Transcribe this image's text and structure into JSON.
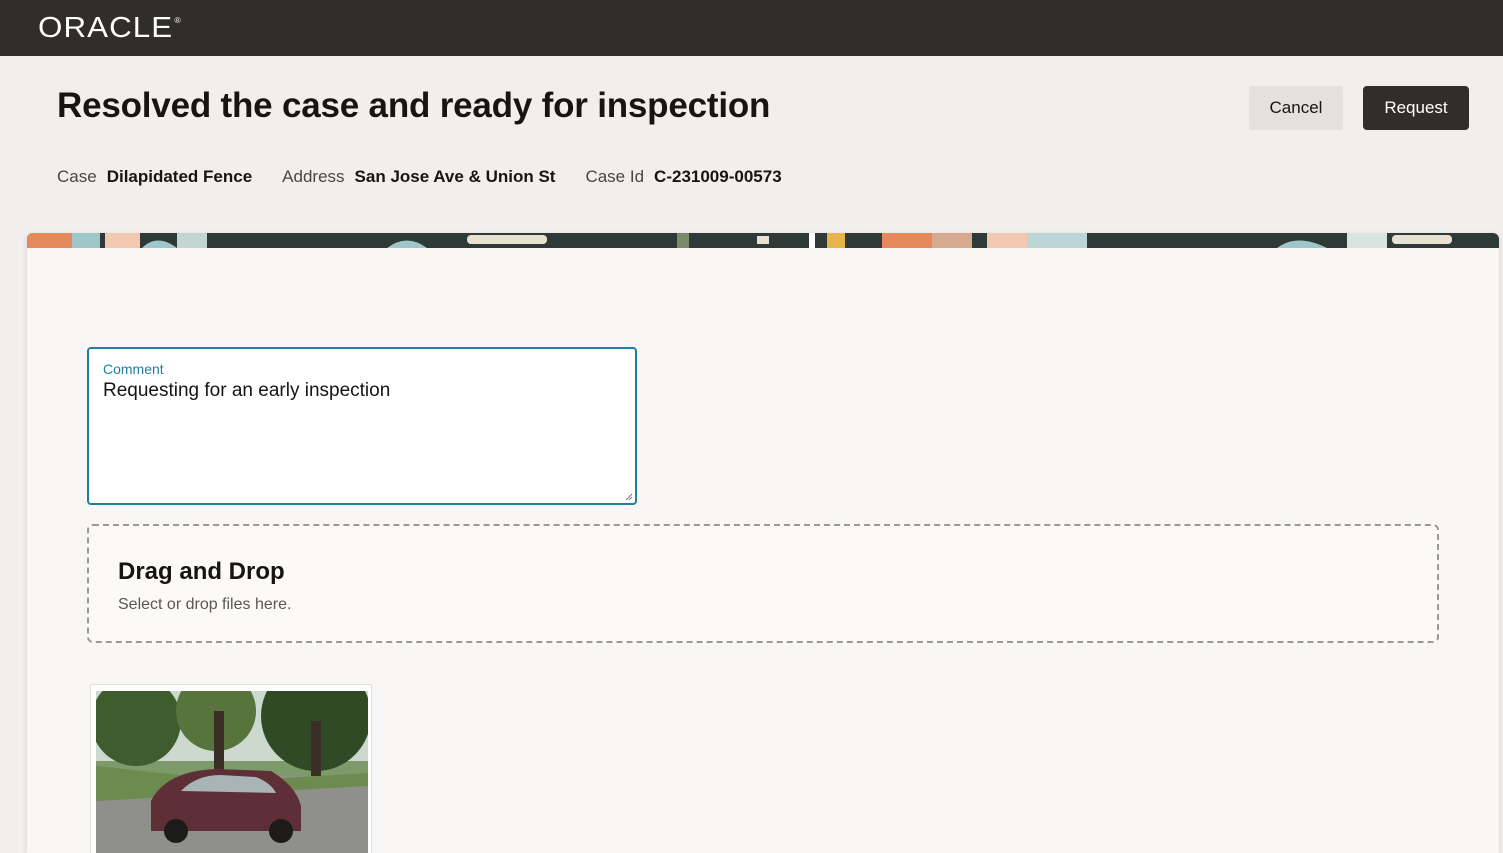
{
  "header": {
    "logo_text": "ORACLE",
    "logo_mark": "®"
  },
  "page": {
    "title": "Resolved the case and ready for inspection"
  },
  "actions": {
    "cancel_label": "Cancel",
    "request_label": "Request"
  },
  "case_info": {
    "case_label": "Case",
    "case_value": "Dilapidated Fence",
    "address_label": "Address",
    "address_value": "San Jose Ave & Union St",
    "case_id_label": "Case Id",
    "case_id_value": "C-231009-00573"
  },
  "comment": {
    "label": "Comment",
    "value": "Requesting for an early inspection"
  },
  "dropzone": {
    "title": "Drag and Drop",
    "subtitle": "Select or drop files here."
  },
  "attachments": [
    {
      "icon": "photo-thumbnail"
    }
  ],
  "colors": {
    "header_bg": "#312d2a",
    "focus_accent": "#227e9e",
    "primary_button": "#312d2a",
    "secondary_button": "#e4e1dd"
  }
}
